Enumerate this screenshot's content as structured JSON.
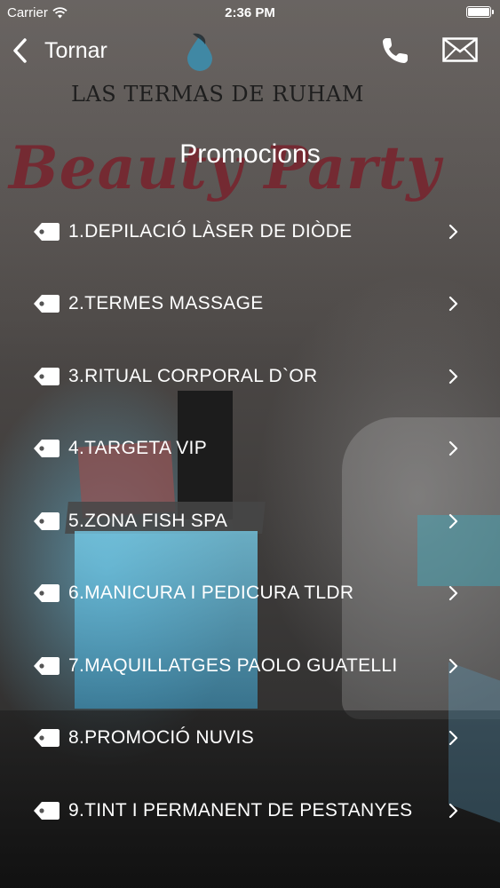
{
  "status_bar": {
    "carrier": "Carrier",
    "time": "2:36 PM",
    "battery_level": 1.0
  },
  "background": {
    "brand_text": "LAS TERMAS DE RUHAM",
    "script_text": "Beauty Party"
  },
  "nav": {
    "back_label": "Tornar",
    "title": "Promocions"
  },
  "promotions": [
    "1.DEPILACIÓ LÀSER DE DIÒDE",
    "2.TERMES MASSAGE",
    "3.RITUAL CORPORAL D`OR",
    "4.TARGETA VIP",
    "5.ZONA FISH SPA",
    "6.MANICURA I PEDICURA TLDR",
    "7.MAQUILLATGES PAOLO GUATELLI",
    "8.PROMOCIÓ NUVIS",
    "9.TINT I PERMANENT DE PESTANYES"
  ],
  "icons": {
    "row_icon": "tag-icon",
    "row_chevron": "chevron-right-icon"
  }
}
